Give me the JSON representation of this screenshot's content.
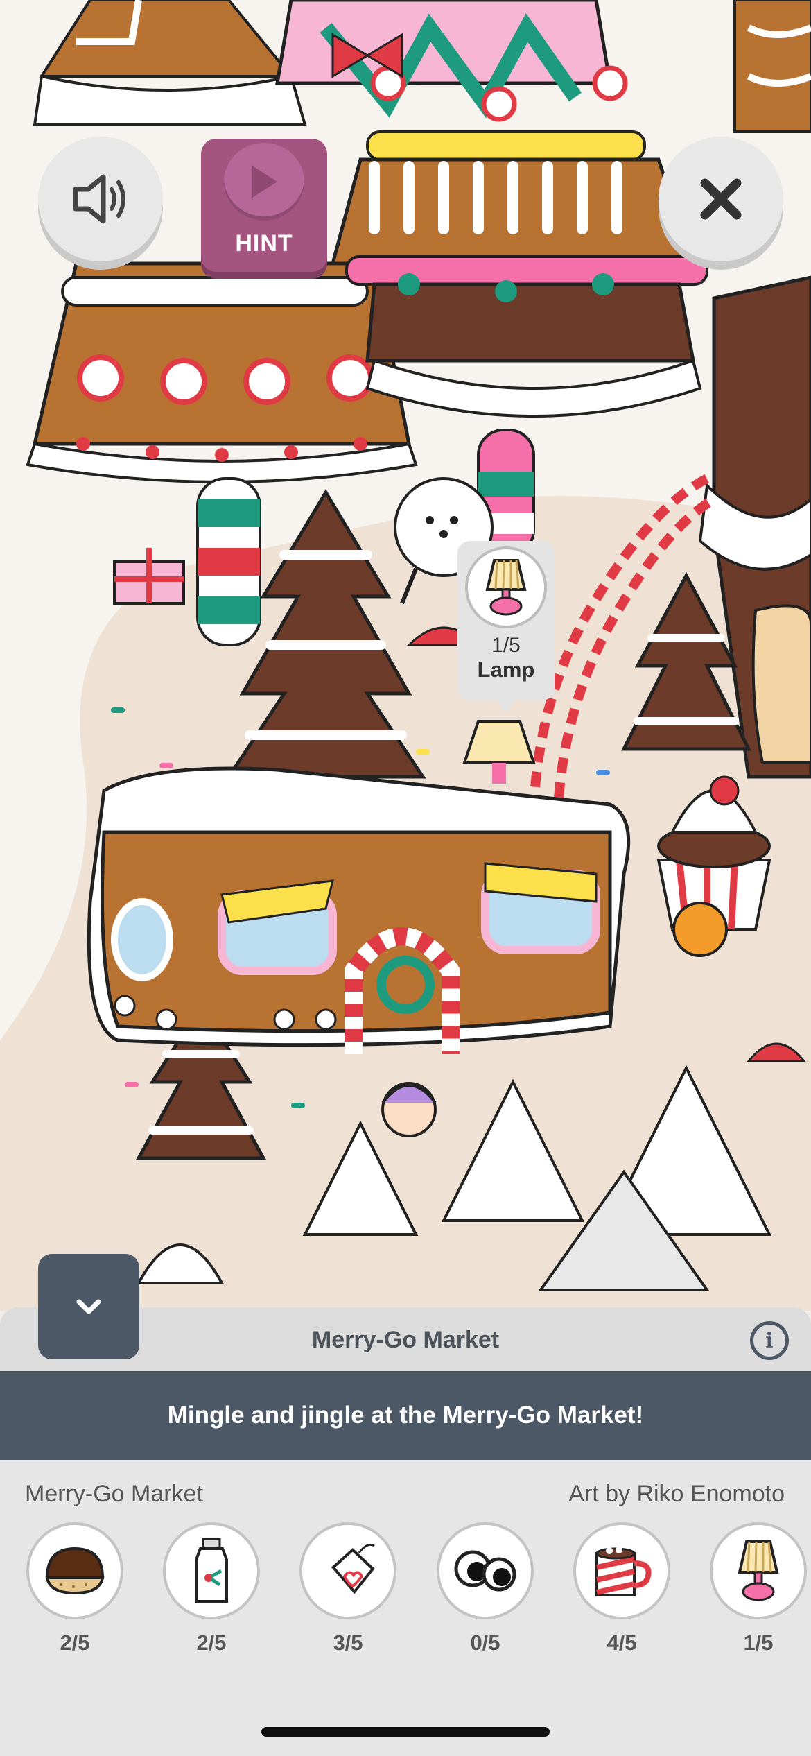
{
  "hud": {
    "hint_label": "HINT"
  },
  "found_marker": {
    "count": "1/5",
    "name": "Lamp"
  },
  "panel": {
    "title": "Merry-Go Market",
    "info_glyph": "i",
    "banner_text": "Mingle and jingle at the Merry-Go Market!",
    "location_name": "Merry-Go Market",
    "artist_credit": "Art by Riko Enomoto"
  },
  "items": [
    {
      "icon": "chestnut-icon",
      "count": "2/5"
    },
    {
      "icon": "milk-bottle-icon",
      "count": "2/5"
    },
    {
      "icon": "gift-tag-icon",
      "count": "3/5"
    },
    {
      "icon": "googly-eyes-icon",
      "count": "0/5"
    },
    {
      "icon": "hot-cocoa-mug-icon",
      "count": "4/5"
    },
    {
      "icon": "lamp-icon",
      "count": "1/5"
    }
  ],
  "colors": {
    "panel_dark": "#4d5866",
    "hint_purple": "#a4557f",
    "gingerbread": "#b87333",
    "candy_red": "#e03a45",
    "mint": "#1e9b7f"
  }
}
